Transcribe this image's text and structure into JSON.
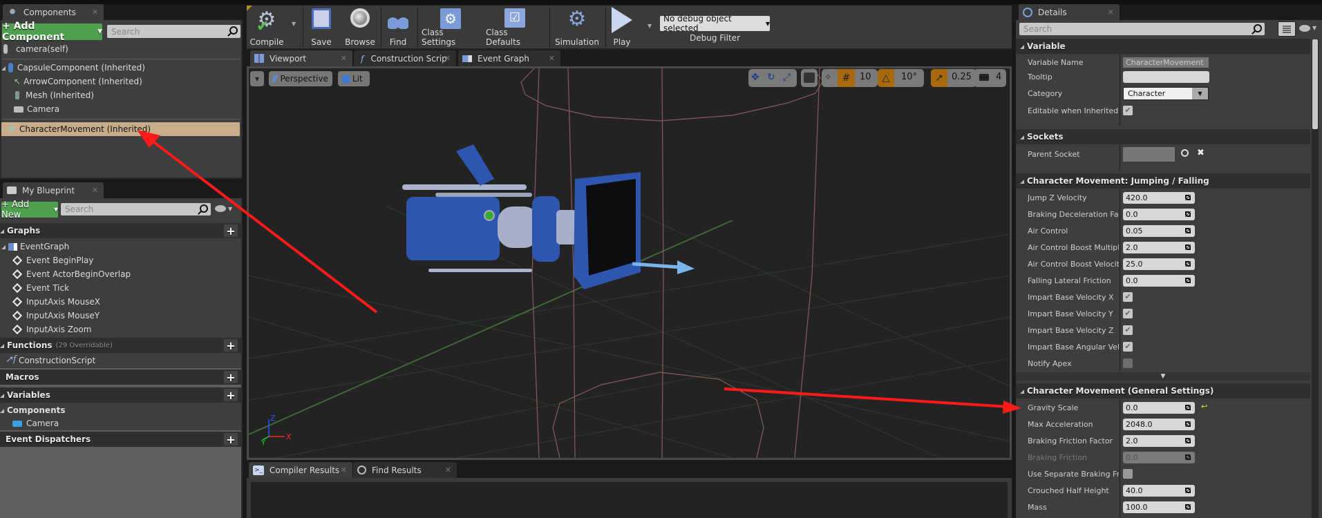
{
  "components_panel": {
    "tab_label": "Components",
    "add_component_label": "+ Add Component",
    "search_placeholder": "Search",
    "self_item": "camera(self)",
    "tree": [
      {
        "label": "CapsuleComponent (Inherited)",
        "icon": "capsule-icon"
      },
      {
        "label": "ArrowComponent (Inherited)",
        "icon": "arrow-component-icon"
      },
      {
        "label": "Mesh (Inherited)",
        "icon": "skeletal-mesh-icon"
      },
      {
        "label": "Camera",
        "icon": "camera-icon"
      }
    ],
    "selected_item": "CharacterMovement (Inherited)"
  },
  "my_blueprint": {
    "tab_label": "My Blueprint",
    "add_new_label": "+ Add New",
    "search_placeholder": "Search",
    "graphs_label": "Graphs",
    "event_graph_label": "EventGraph",
    "events": [
      "Event BeginPlay",
      "Event ActorBeginOverlap",
      "Event Tick",
      "InputAxis MouseX",
      "InputAxis MouseY",
      "InputAxis Zoom"
    ],
    "functions_label": "Functions",
    "functions_overridable": "(29 Overridable)",
    "construction_script": "ConstructionScript",
    "macros_label": "Macros",
    "variables_label": "Variables",
    "components_label": "Components",
    "camera_var": "Camera",
    "event_dispatchers_label": "Event Dispatchers"
  },
  "toolbar": {
    "compile": "Compile",
    "save": "Save",
    "browse": "Browse",
    "find": "Find",
    "class_settings": "Class Settings",
    "class_defaults": "Class Defaults",
    "simulation": "Simulation",
    "play": "Play",
    "debug_object": "No debug object selected",
    "debug_filter": "Debug Filter"
  },
  "editor_tabs": [
    {
      "label": "Viewport",
      "active": true
    },
    {
      "label": "Construction Scrip",
      "active": false
    },
    {
      "label": "Event Graph",
      "active": false
    }
  ],
  "viewport": {
    "view_mode": "Perspective",
    "lighting": "Lit",
    "grid_snap": "10",
    "rotation_snap": "10°",
    "scale_snap": "0.25",
    "camera_speed": "4",
    "axis_labels": {
      "x": "X",
      "y": "Y",
      "z": "Z"
    }
  },
  "bottom_tabs": [
    {
      "label": "Compiler Results"
    },
    {
      "label": "Find Results"
    }
  ],
  "details": {
    "tab_label": "Details",
    "search_placeholder": "Search",
    "sections": {
      "variable": {
        "title": "Variable",
        "variable_name_label": "Variable Name",
        "variable_name_value": "CharacterMovement",
        "tooltip_label": "Tooltip",
        "tooltip_value": "",
        "category_label": "Category",
        "category_value": "Character",
        "editable_label": "Editable when Inherited",
        "editable_checked": true
      },
      "sockets": {
        "title": "Sockets",
        "parent_socket_label": "Parent Socket",
        "parent_socket_value": ""
      },
      "jumping": {
        "title": "Character Movement: Jumping / Falling",
        "numeric": [
          {
            "label": "Jump Z Velocity",
            "value": "420.0"
          },
          {
            "label": "Braking Deceleration Falling",
            "value": "0.0"
          },
          {
            "label": "Air Control",
            "value": "0.05"
          },
          {
            "label": "Air Control Boost Multiplier",
            "value": "2.0"
          },
          {
            "label": "Air Control Boost Velocity Threshold",
            "value": "25.0"
          },
          {
            "label": "Falling Lateral Friction",
            "value": "0.0"
          }
        ],
        "checks": [
          {
            "label": "Impart Base Velocity X",
            "checked": true
          },
          {
            "label": "Impart Base Velocity Y",
            "checked": true
          },
          {
            "label": "Impart Base Velocity Z",
            "checked": true
          },
          {
            "label": "Impart Base Angular Velocity",
            "checked": true
          },
          {
            "label": "Notify Apex",
            "checked": false
          }
        ]
      },
      "general": {
        "title": "Character Movement (General Settings)",
        "gravity_scale_label": "Gravity Scale",
        "gravity_scale_value": "0.0",
        "max_accel_label": "Max Acceleration",
        "max_accel_value": "2048.0",
        "braking_factor_label": "Braking Friction Factor",
        "braking_factor_value": "2.0",
        "braking_friction_label": "Braking Friction",
        "braking_friction_value": "0.0",
        "use_separate_label": "Use Separate Braking Friction",
        "use_separate_checked": false,
        "crouched_label": "Crouched Half Height",
        "crouched_value": "40.0",
        "mass_label": "Mass",
        "mass_value": "100.0"
      }
    }
  },
  "colors": {
    "selection": "#c8ad8a",
    "add_green": "#4da04d",
    "snap_orange": "#a8690e",
    "annotation_red": "#ff1a1a"
  }
}
